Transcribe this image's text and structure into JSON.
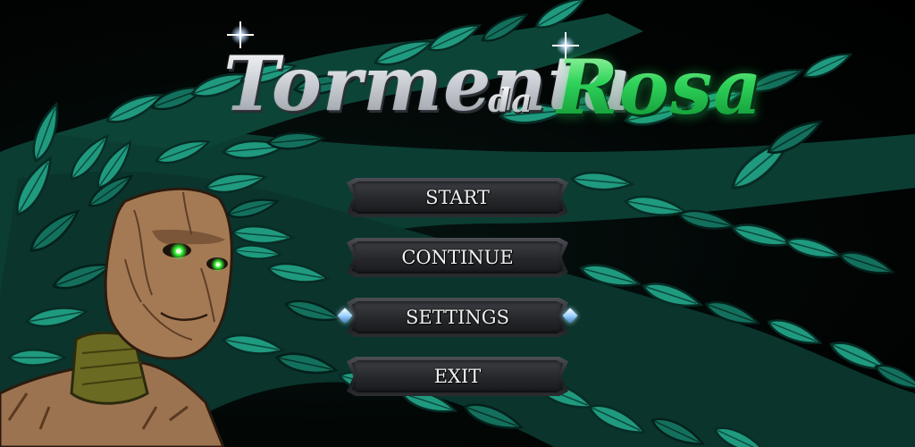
{
  "game": {
    "title_word_1": "Tormenta",
    "title_word_2": "da",
    "title_word_3": "Rosa"
  },
  "menu": {
    "items": [
      {
        "label": "START"
      },
      {
        "label": "CONTINUE"
      },
      {
        "label": "SETTINGS",
        "selected": true
      },
      {
        "label": "EXIT"
      }
    ]
  },
  "colors": {
    "leaf": "#1f9a7f",
    "leaf_dark": "#0f5e4d",
    "title_silver": "#d8dadf",
    "title_green": "#2fd35a",
    "eye_glow": "#39ff3c",
    "bark": "#a47a55",
    "moss": "#6b6a22",
    "selector_gem": "#9fd3ff"
  },
  "icons": [
    "sparkle-icon",
    "selector-gem-icon"
  ]
}
